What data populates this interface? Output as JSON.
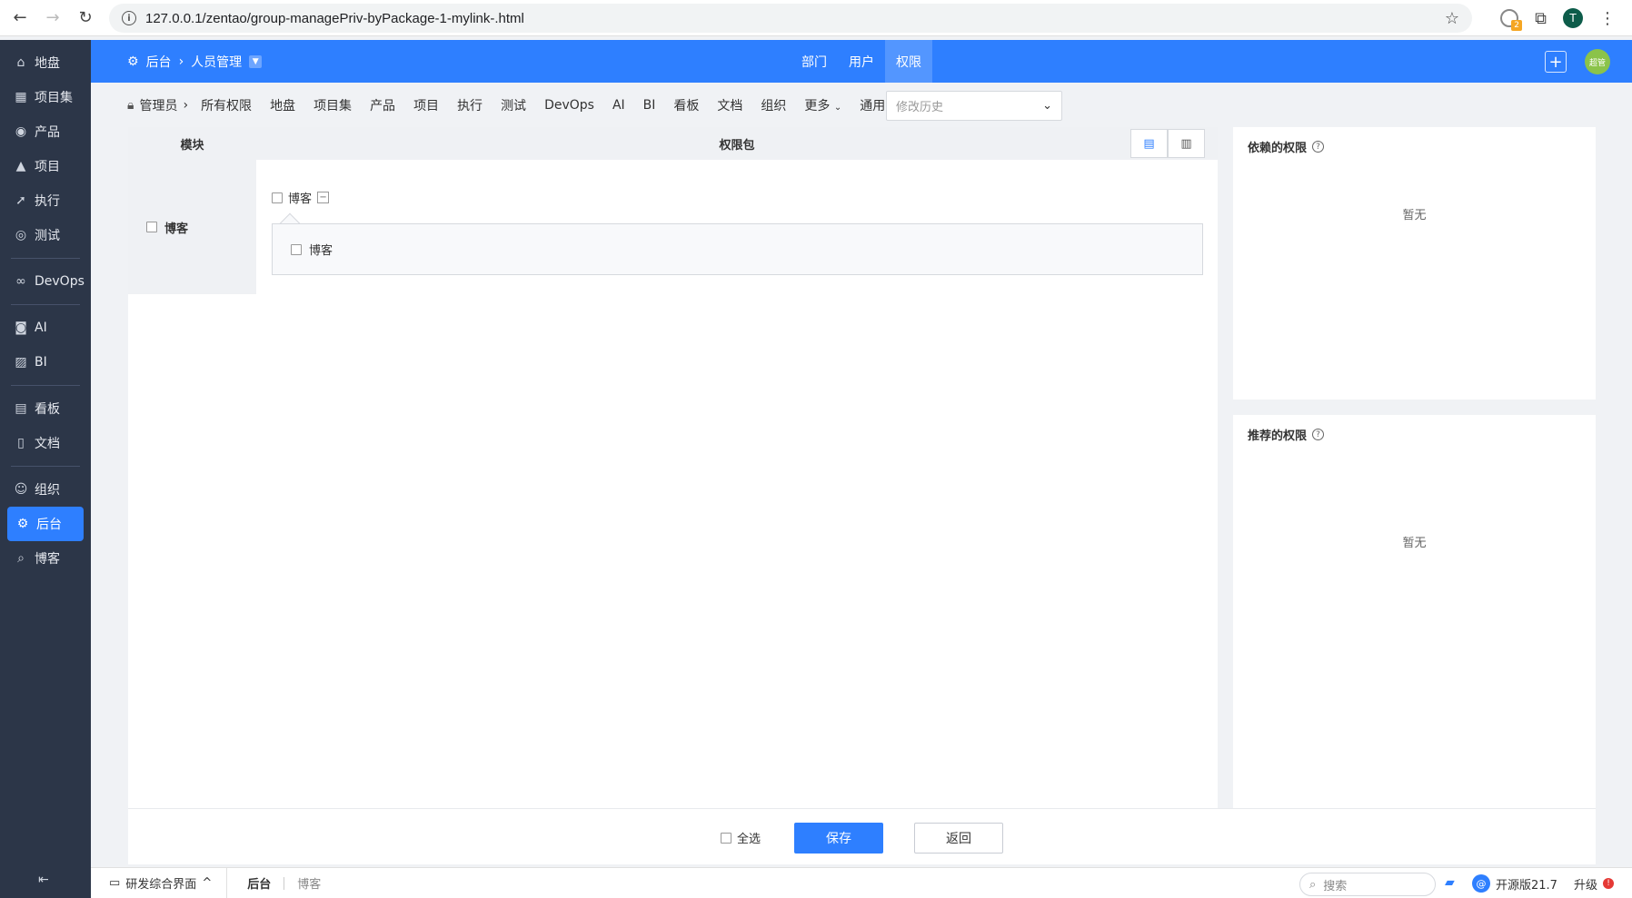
{
  "browser": {
    "url": "127.0.0.1/zentao/group-managePriv-byPackage-1-mylink-.html",
    "profile_initial": "T",
    "extension_badge": "2"
  },
  "sidebar": {
    "items": [
      {
        "label": "地盘",
        "icon": "home-icon"
      },
      {
        "label": "项目集",
        "icon": "grid-icon"
      },
      {
        "label": "产品",
        "icon": "location-icon"
      },
      {
        "label": "项目",
        "icon": "rocket-icon"
      },
      {
        "label": "执行",
        "icon": "rocket-launch-icon"
      },
      {
        "label": "测试",
        "icon": "search-bug-icon"
      },
      {
        "label": "DevOps",
        "icon": "infinity-icon"
      },
      {
        "label": "AI",
        "icon": "robot-icon"
      },
      {
        "label": "BI",
        "icon": "chart-icon"
      },
      {
        "label": "看板",
        "icon": "kanban-icon"
      },
      {
        "label": "文档",
        "icon": "document-icon"
      },
      {
        "label": "组织",
        "icon": "people-icon"
      },
      {
        "label": "后台",
        "icon": "gear-icon"
      },
      {
        "label": "博客",
        "icon": "search-icon"
      }
    ],
    "active": "后台"
  },
  "header": {
    "crumb_root": "后台",
    "crumb_current": "人员管理",
    "tabs": [
      "部门",
      "用户",
      "权限"
    ],
    "active_tab": "权限",
    "avatar_text": "超管"
  },
  "subnav": {
    "items": [
      "管理员",
      "所有权限",
      "地盘",
      "项目集",
      "产品",
      "项目",
      "执行",
      "测试",
      "DevOps",
      "AI",
      "BI",
      "看板",
      "文档",
      "组织",
      "更多",
      "通用"
    ],
    "history_placeholder": "修改历史"
  },
  "table": {
    "col_module": "模块",
    "col_package": "权限包",
    "module_name": "博客",
    "package_name": "博客",
    "privilege_name": "博客"
  },
  "depends": {
    "title": "依赖的权限",
    "empty": "暂无"
  },
  "recommend": {
    "title": "推荐的权限",
    "empty": "暂无"
  },
  "actions": {
    "select_all": "全选",
    "save": "保存",
    "back": "返回"
  },
  "statusbar": {
    "workspace": "研发综合界面",
    "crumb_main": "后台",
    "crumb_sub": "博客",
    "search_placeholder": "搜索",
    "version": "开源版21.7",
    "upgrade": "升级"
  },
  "colors": {
    "primary": "#2e7fff",
    "sidebar_bg": "#2c3648"
  }
}
